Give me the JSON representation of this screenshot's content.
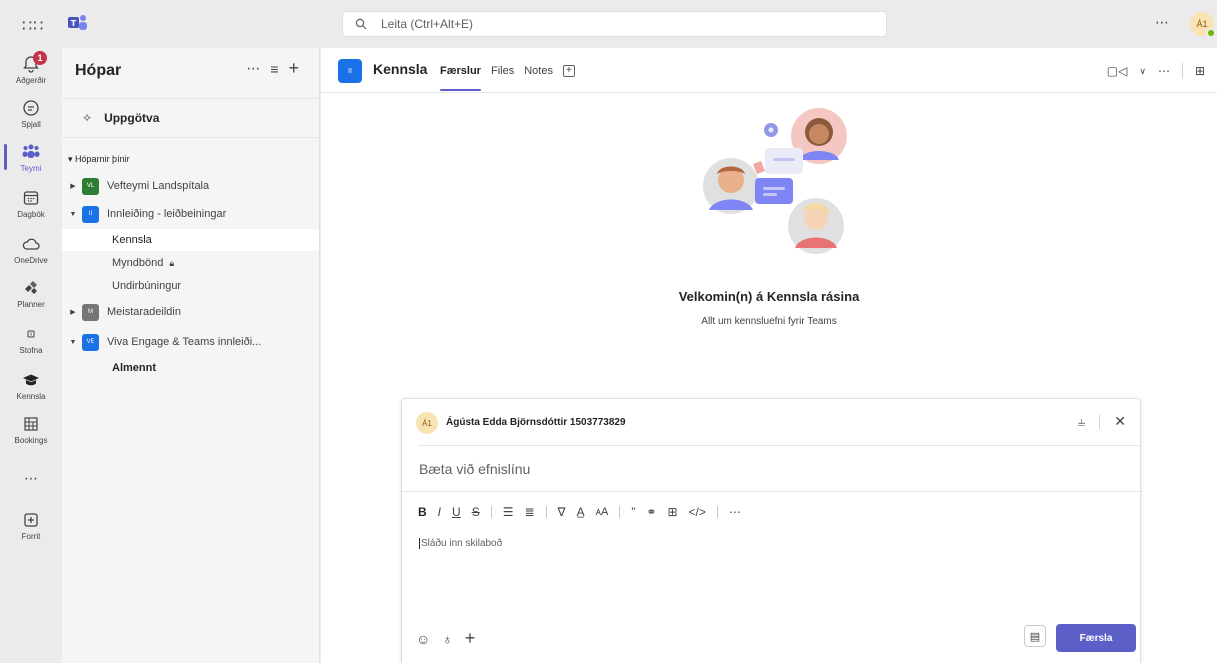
{
  "topbar": {
    "search_placeholder": "Leita (Ctrl+Alt+E)",
    "more_label": "⋯",
    "avatar_initials": "Á1"
  },
  "rail": {
    "items": [
      {
        "label": "Aðgerðir",
        "icon": "bell-icon",
        "badge": "1"
      },
      {
        "label": "Spjall",
        "icon": "chat-icon"
      },
      {
        "label": "Teymi",
        "icon": "teams-icon",
        "active": true
      },
      {
        "label": "Dagbók",
        "icon": "calendar-icon"
      },
      {
        "label": "OneDrive",
        "icon": "cloud-icon"
      },
      {
        "label": "Planner",
        "icon": "planner-icon"
      },
      {
        "label": "Stofna",
        "icon": "create-icon"
      },
      {
        "label": "Kennsla",
        "icon": "graduation-cap-icon"
      },
      {
        "label": "Bookings",
        "icon": "bookings-icon"
      },
      {
        "label": "⋯",
        "icon": "more-apps-icon"
      },
      {
        "label": "Forrit",
        "icon": "add-app-icon"
      }
    ]
  },
  "panel": {
    "title": "Hópar",
    "discover_label": "Uppgötva",
    "section_label": "Hóparnir þínir",
    "teams": [
      {
        "name": "Vefteymi Landspítala",
        "initials": "VL",
        "color": "#2e7d32",
        "expanded": false
      },
      {
        "name": "Innleiðing - leiðbeiningar",
        "initials": "II",
        "color": "#1b72e8",
        "expanded": true
      },
      {
        "name": "Meistaradeildin",
        "initials": "M",
        "color": "#757575",
        "expanded": false
      },
      {
        "name": "Viva Engage & Teams innleiði...",
        "initials": "VE",
        "color": "#1b72e8",
        "expanded": true
      }
    ],
    "channels": [
      {
        "name": "Kennsla",
        "selected": true
      },
      {
        "name": "Myndbönd",
        "locked": true
      },
      {
        "name": "Undirbúningur"
      },
      {
        "name": "Almennt",
        "bold": true
      }
    ]
  },
  "channel": {
    "avatar_initials": "II",
    "name": "Kennsla",
    "tabs": [
      "Færslur",
      "Files",
      "Notes"
    ],
    "active_tab": "Færslur",
    "welcome_title": "Velkomin(n) á Kennsla rásina",
    "welcome_sub": "Allt um kennsluefni fyrir Teams"
  },
  "compose": {
    "avatar_initials": "Á1",
    "user": "Ágústa Edda Björnsdóttir 1503773829",
    "subject_placeholder": "Bæta við efnislínu",
    "body_placeholder": "Sláðu inn skilaboð",
    "post_label": "Færsla"
  },
  "colors": {
    "accent": "#5b5fc7",
    "badge": "#c4314b",
    "presence": "#6bb700"
  }
}
